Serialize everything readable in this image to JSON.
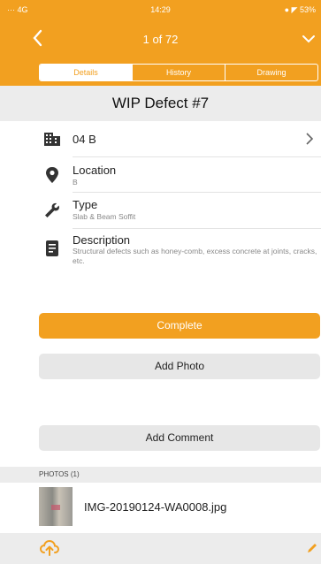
{
  "status": {
    "left": "··· 4G",
    "time": "14:29",
    "right": "● ◤ 53%"
  },
  "nav": {
    "title": "1 of 72"
  },
  "tabs": [
    "Details",
    "History",
    "Drawing"
  ],
  "header": {
    "title": "WIP Defect #7"
  },
  "rows": {
    "unit": {
      "value": "04 B"
    },
    "location": {
      "label": "Location",
      "value": "B"
    },
    "type": {
      "label": "Type",
      "value": "Slab & Beam Soffit"
    },
    "description": {
      "label": "Description",
      "value": "Structural defects such as honey-comb, excess concrete at joints, cracks, etc."
    }
  },
  "buttons": {
    "complete": "Complete",
    "add_photo": "Add Photo",
    "add_comment": "Add Comment"
  },
  "photos": {
    "header": "PHOTOS (1)",
    "items": [
      {
        "name": "IMG-20190124-WA0008.jpg"
      }
    ]
  },
  "colors": {
    "accent": "#f2a020",
    "panel": "#ececec"
  }
}
